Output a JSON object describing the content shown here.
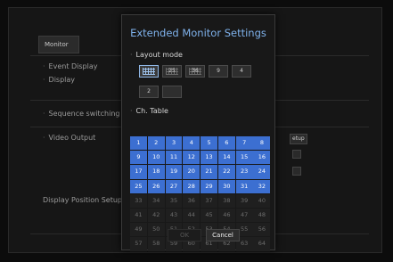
{
  "background": {
    "tab_label": "Monitor",
    "items": {
      "event_display": "Event Display",
      "display": "Display",
      "sequence_switching": "Sequence switching ti",
      "video_output": "Video Output",
      "display_position": "Display Position Setup"
    },
    "setup_button": "etup"
  },
  "dialog": {
    "title": "Extended Monitor Settings",
    "layout_label": "Layout mode",
    "layout_buttons": [
      "",
      "25",
      "36",
      "9",
      "4",
      "2",
      ""
    ],
    "selected_layout_index": 0,
    "ch_table_label": "Ch. Table",
    "channels": [
      1,
      2,
      3,
      4,
      5,
      6,
      7,
      8,
      9,
      10,
      11,
      12,
      13,
      14,
      15,
      16,
      17,
      18,
      19,
      20,
      21,
      22,
      23,
      24,
      25,
      26,
      27,
      28,
      29,
      30,
      31,
      32,
      33,
      34,
      35,
      36,
      37,
      38,
      39,
      40,
      41,
      42,
      43,
      44,
      45,
      46,
      47,
      48,
      49,
      50,
      51,
      52,
      53,
      54,
      55,
      56,
      57,
      58,
      59,
      60,
      61,
      62,
      63,
      64
    ],
    "active_channel_count": 32,
    "ok_label": "OK",
    "cancel_label": "Cancel"
  },
  "colors": {
    "title": "#7fb2ec",
    "channel_active": "#3c6fd1",
    "channel_inactive": "#1f1f1f"
  }
}
